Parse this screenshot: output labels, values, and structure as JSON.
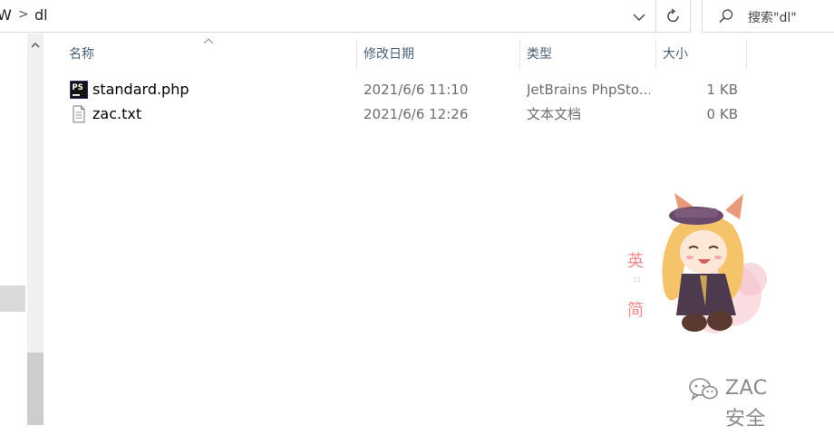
{
  "address_bar": {
    "prev_segment": "W",
    "separator": ">",
    "current_folder": "dl"
  },
  "search": {
    "placeholder": "搜索\"dl\""
  },
  "columns": {
    "name": "名称",
    "date_modified": "修改日期",
    "type": "类型",
    "size": "大小",
    "sort_indicator": "ascending"
  },
  "files": [
    {
      "name": "standard.php",
      "date": "2021/6/6 11:10",
      "type": "JetBrains PhpSto...",
      "size": "1 KB",
      "icon": "phpstorm-file-icon"
    },
    {
      "name": "zac.txt",
      "date": "2021/6/6 12:26",
      "type": "文本文档",
      "size": "0 KB",
      "icon": "text-file-icon"
    }
  ],
  "decoration": {
    "mascot_text": [
      "英",
      "简"
    ],
    "watermark": "ZAC安全"
  },
  "colors": {
    "header_text": "#4c607a",
    "meta_text": "#6d6d6d",
    "border": "#d9d9d9"
  }
}
